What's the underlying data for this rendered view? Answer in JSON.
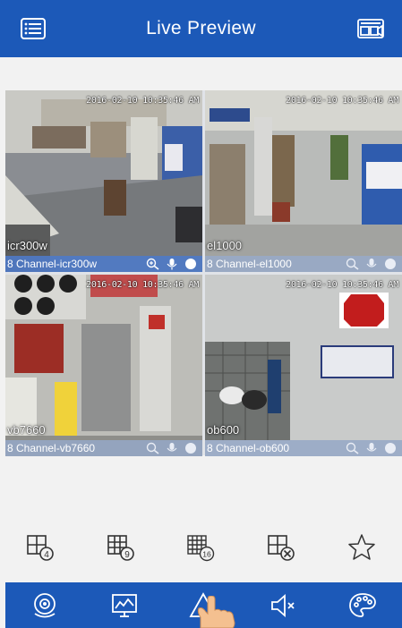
{
  "header": {
    "title": "Live Preview",
    "menu_icon": "list-menu-icon",
    "view_icon": "preview-view-icon"
  },
  "tiles": [
    {
      "timestamp": "2016-02-10 10:35:46 AM",
      "camera_label": "icr300w",
      "channel_label": "8 Channel-icr300w",
      "active": true
    },
    {
      "timestamp": "2016-02-10 10:35:46 AM",
      "camera_label": "el1000",
      "channel_label": "8 Channel-el1000",
      "active": false
    },
    {
      "timestamp": "2016-02-10 10:35:46 AM",
      "camera_label": "vb7660",
      "channel_label": "8 Channel-vb7660",
      "active": false
    },
    {
      "timestamp": "2016-02-10 10:35:46 AM",
      "camera_label": "ob600",
      "channel_label": "8 Channel-ob600",
      "active": false
    }
  ],
  "toolbar": {
    "items": [
      {
        "icon": "grid-4-icon",
        "badge": "4"
      },
      {
        "icon": "grid-9-icon",
        "badge": "9"
      },
      {
        "icon": "grid-16-icon",
        "badge": "16"
      },
      {
        "icon": "grid-close-icon",
        "badge": ""
      },
      {
        "icon": "star-icon",
        "badge": ""
      }
    ]
  },
  "bottom_nav": {
    "items": [
      "eye-icon",
      "monitor-chart-icon",
      "alarm-icon",
      "mute-icon",
      "palette-icon"
    ]
  },
  "colors": {
    "header": "#1c59b8",
    "active_bar": "#4d7ac9",
    "background": "#f2f2f2"
  }
}
